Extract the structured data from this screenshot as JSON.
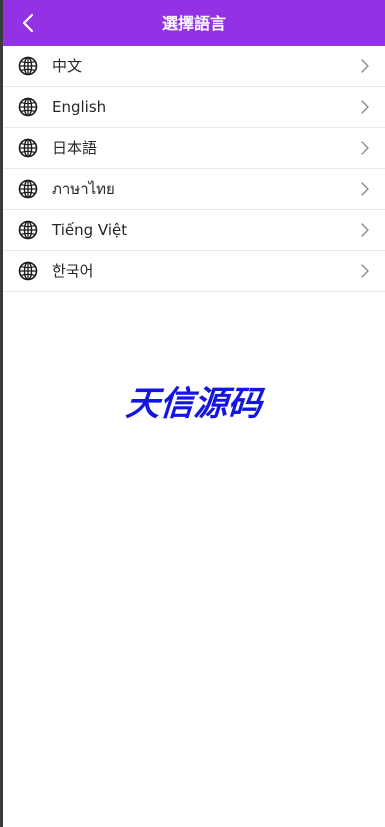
{
  "header": {
    "title": "選擇語言",
    "back_icon": "chevron-left-icon",
    "background": "#9331e4"
  },
  "languages": [
    {
      "label": "中文",
      "icon": "globe-icon"
    },
    {
      "label": "English",
      "icon": "globe-icon"
    },
    {
      "label": "日本語",
      "icon": "globe-icon"
    },
    {
      "label": "ภาษาไทย",
      "icon": "globe-icon"
    },
    {
      "label": "Tiếng Việt",
      "icon": "globe-icon"
    },
    {
      "label": "한국어",
      "icon": "globe-icon"
    }
  ],
  "watermark": {
    "text": "天信源码",
    "color": "#1515e0"
  }
}
